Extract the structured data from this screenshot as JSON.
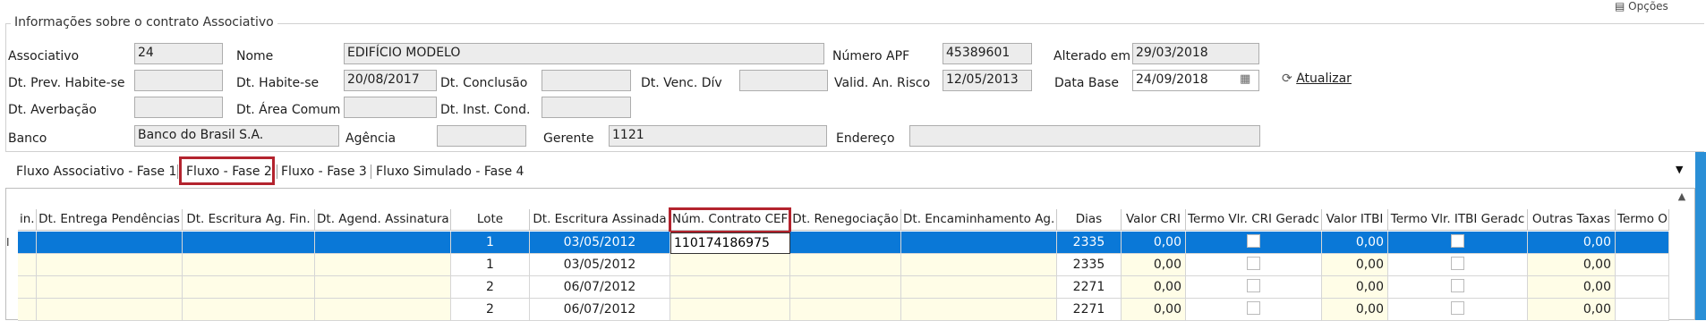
{
  "window": {
    "top_button_label": "Opções"
  },
  "group": {
    "title": "Informações sobre o contrato Associativo"
  },
  "fields": {
    "associativo": {
      "label": "Associativo",
      "value": "24"
    },
    "nome": {
      "label": "Nome",
      "value": "EDIFÍCIO MODELO"
    },
    "numero_apf": {
      "label": "Número APF",
      "value": "45389601"
    },
    "alterado_em": {
      "label": "Alterado em",
      "value": "29/03/2018"
    },
    "dt_prev_habite_se": {
      "label": "Dt. Prev. Habite-se",
      "value": ""
    },
    "dt_habite_se": {
      "label": "Dt. Habite-se",
      "value": "20/08/2017"
    },
    "dt_conclusao": {
      "label": "Dt. Conclusão",
      "value": ""
    },
    "dt_venc_div": {
      "label": "Dt. Venc. Dív",
      "value": ""
    },
    "valid_an_risco": {
      "label": "Valid. An. Risco",
      "value": "12/05/2013"
    },
    "data_base": {
      "label": "Data Base",
      "value": "24/09/2018"
    },
    "dt_averbacao": {
      "label": "Dt. Averbação",
      "value": ""
    },
    "dt_area_comum": {
      "label": "Dt. Área Comum",
      "value": ""
    },
    "dt_inst_cond": {
      "label": "Dt. Inst. Cond.",
      "value": ""
    },
    "banco": {
      "label": "Banco",
      "value": "Banco do Brasil S.A."
    },
    "agencia": {
      "label": "Agência",
      "value": ""
    },
    "gerente": {
      "label": "Gerente",
      "value": "1121"
    },
    "endereco": {
      "label": "Endereço",
      "value": ""
    }
  },
  "actions": {
    "atualizar": "Atualizar"
  },
  "icons": {
    "refresh": "refresh-icon",
    "calendar": "calendar-icon",
    "dropdown": "chevron-down-icon",
    "scroll_up": "scroll-up-icon",
    "row_cursor": "text-cursor-icon"
  },
  "tabs": [
    {
      "label": "Fluxo Associativo - Fase 1"
    },
    {
      "label": "Fluxo - Fase 2",
      "active": true
    },
    {
      "label": "Fluxo - Fase 3"
    },
    {
      "label": "Fluxo Simulado - Fase 4"
    }
  ],
  "grid": {
    "columns": [
      "in.",
      "Dt. Entrega Pendências",
      "Dt. Escritura Ag. Fin.",
      "Dt. Agend. Assinatura",
      "Lote",
      "Dt. Escritura Assinada",
      "Núm. Contrato CEF",
      "Dt. Renegociação",
      "Dt. Encaminhamento Ag.",
      "Dias",
      "Valor CRI",
      "Termo Vlr. CRI Geradc",
      "Valor ITBI",
      "Termo Vlr. ITBI Geradc",
      "Outras Taxas",
      "Termo Ou"
    ],
    "rows": [
      {
        "lote": "1",
        "dt_escritura_assinada": "03/05/2012",
        "num_contrato_cef": "110174186975",
        "dias": "2335",
        "valor_cri": "0,00",
        "valor_itbi": "0,00",
        "outras_taxas": "0,00",
        "selected": true
      },
      {
        "lote": "1",
        "dt_escritura_assinada": "03/05/2012",
        "num_contrato_cef": "",
        "dias": "2335",
        "valor_cri": "0,00",
        "valor_itbi": "0,00",
        "outras_taxas": "0,00"
      },
      {
        "lote": "2",
        "dt_escritura_assinada": "06/07/2012",
        "num_contrato_cef": "",
        "dias": "2271",
        "valor_cri": "0,00",
        "valor_itbi": "0,00",
        "outras_taxas": "0,00"
      },
      {
        "lote": "2",
        "dt_escritura_assinada": "06/07/2012",
        "num_contrato_cef": "",
        "dias": "2271",
        "valor_cri": "0,00",
        "valor_itbi": "0,00",
        "outras_taxas": "0,00"
      }
    ]
  },
  "colors": {
    "selection": "#0a78d7",
    "highlight_border": "#b3232e",
    "editable_bg": "#fffde7",
    "readonly_bg": "#ececec"
  }
}
